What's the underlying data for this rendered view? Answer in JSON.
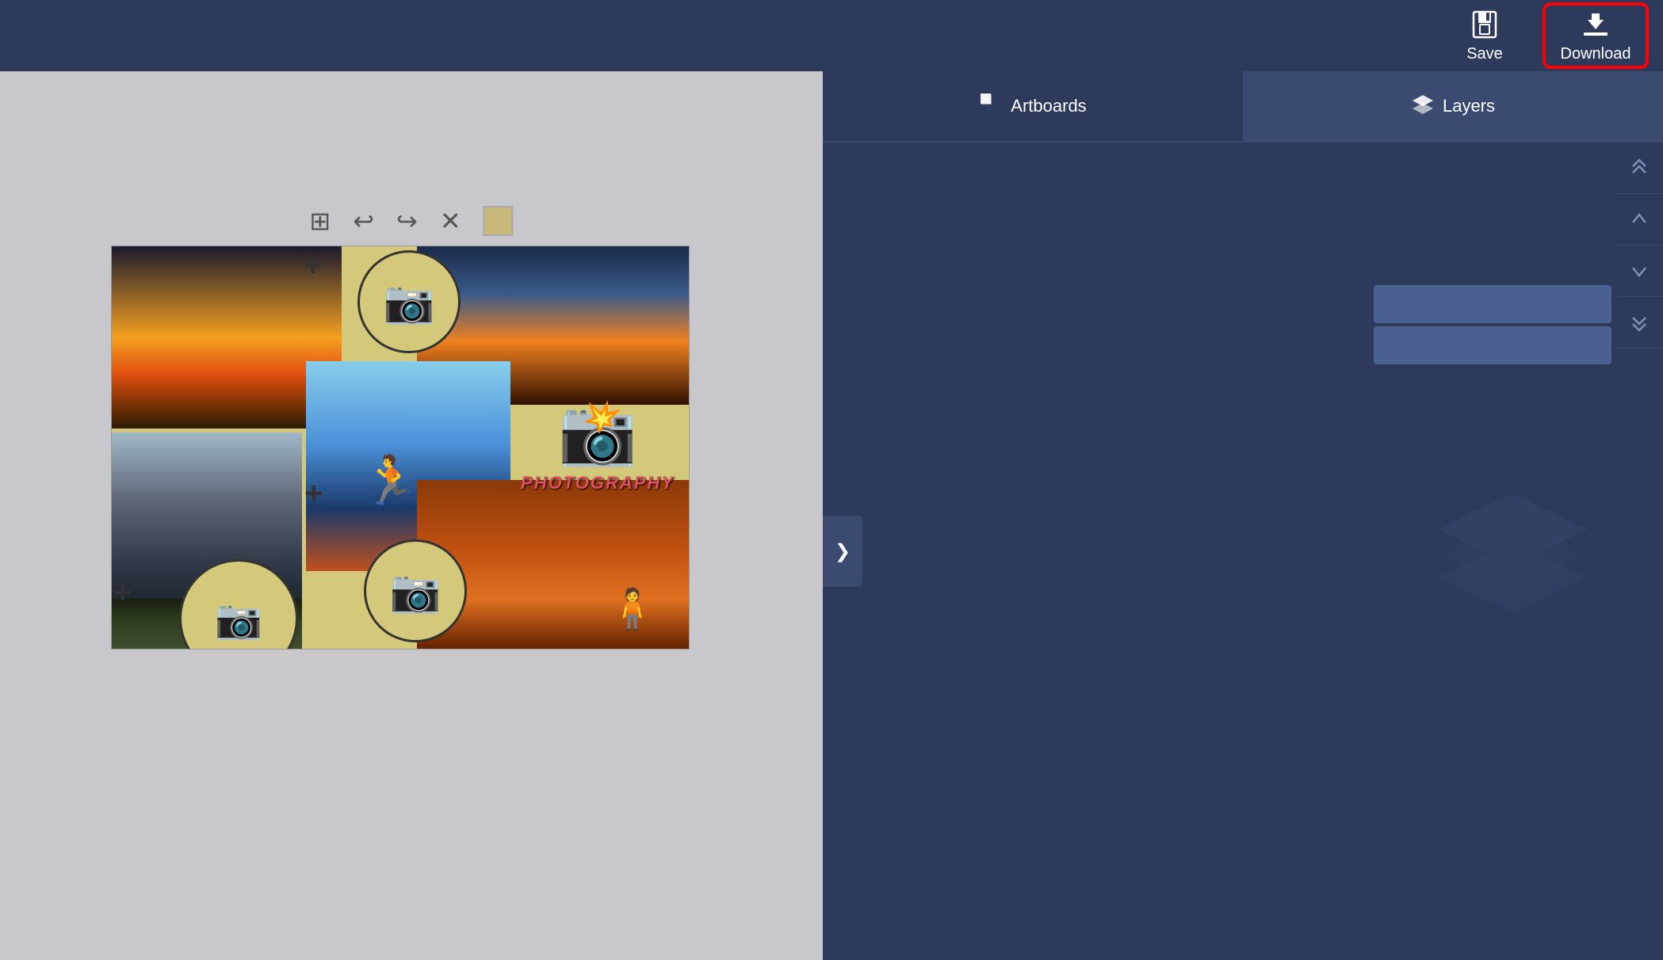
{
  "header": {
    "save_label": "Save",
    "download_label": "Download"
  },
  "tabs": {
    "artboards_label": "Artboards",
    "layers_label": "Layers"
  },
  "toolbar": {
    "grid_icon": "⊞",
    "undo_icon": "↩",
    "redo_icon": "↪",
    "close_icon": "✕",
    "color_swatch": "#c8b87a"
  },
  "panel": {
    "collapse_icon": "❯",
    "arrow_up_double": "⏫",
    "arrow_up": "▲",
    "arrow_down": "▼",
    "arrow_down_double": "⏬"
  },
  "layer_items": [
    {
      "id": 1,
      "selected": true
    },
    {
      "id": 2,
      "selected": true
    }
  ]
}
